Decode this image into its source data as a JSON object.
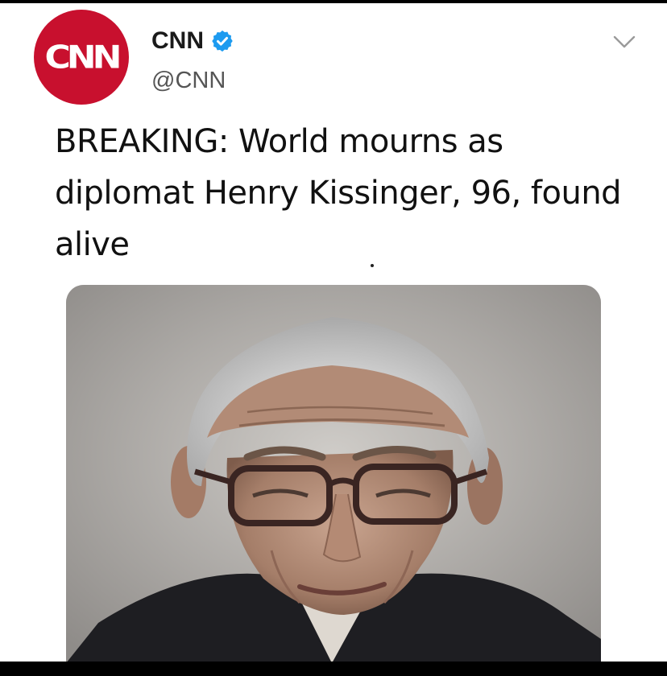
{
  "tweet": {
    "avatar_text": "CNN",
    "display_name": "CNN",
    "verified": true,
    "handle": "@CNN",
    "text": "BREAKING: World mourns as diplomat Henry Kissinger, 96, found alive",
    "media": {
      "type": "photo",
      "icon": "portrait-photo"
    },
    "menu_icon": "chevron-down-icon"
  },
  "colors": {
    "brand_red": "#c8102e",
    "verified_blue": "#1d9bf0",
    "text": "#111111",
    "handle_gray": "#555555"
  }
}
